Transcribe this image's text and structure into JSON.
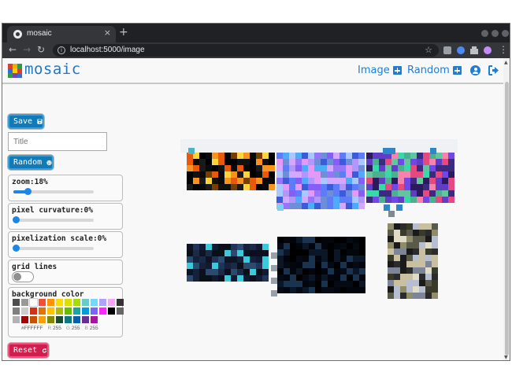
{
  "browser": {
    "tab_title": "mosaic",
    "tab_close": "×",
    "new_tab": "+",
    "url": "localhost:5000/image"
  },
  "header": {
    "brand": "mosaic",
    "nav": [
      {
        "label": "Image"
      },
      {
        "label": "Random"
      }
    ]
  },
  "sidebar": {
    "save_label": "Save",
    "title_placeholder": "Title",
    "random_label": "Random",
    "zoom": {
      "label": "zoom:18%",
      "value": 18
    },
    "curvature": {
      "label": "pixel curvature:0%",
      "value": 0
    },
    "scale": {
      "label": "pixelization scale:0%",
      "value": 0
    },
    "grid": {
      "label": "grid lines",
      "on": false
    },
    "background": {
      "label": "background color",
      "hex": "#FFFFFF",
      "r_label": "R",
      "r": "255",
      "g_label": "G",
      "g": "255",
      "b_label": "B",
      "b": "255",
      "swatches": [
        "#4d4d4d",
        "#999999",
        "#ffffff",
        "#f44e3b",
        "#fe9200",
        "#fcdc00",
        "#dbdf00",
        "#a4dd00",
        "#68ccca",
        "#73d8ff",
        "#aea1ff",
        "#fda1ff",
        "#333333",
        "#808080",
        "#cccccc",
        "#d33115",
        "#e27300",
        "#fcc400",
        "#b0bc00",
        "#68bc00",
        "#16a5a5",
        "#009ce0",
        "#7b64ff",
        "#fa28ff",
        "#000000",
        "#666666",
        "#b3b3b3",
        "#9f0500",
        "#c45100",
        "#fb9e00",
        "#808900",
        "#194d33",
        "#0c797d",
        "#0062b1",
        "#653294",
        "#ab149e"
      ]
    },
    "reset_label": "Reset"
  },
  "colors": {
    "accent": "#1f7ed4",
    "button_blue": "#117ab8",
    "button_red": "#d01e4e"
  }
}
